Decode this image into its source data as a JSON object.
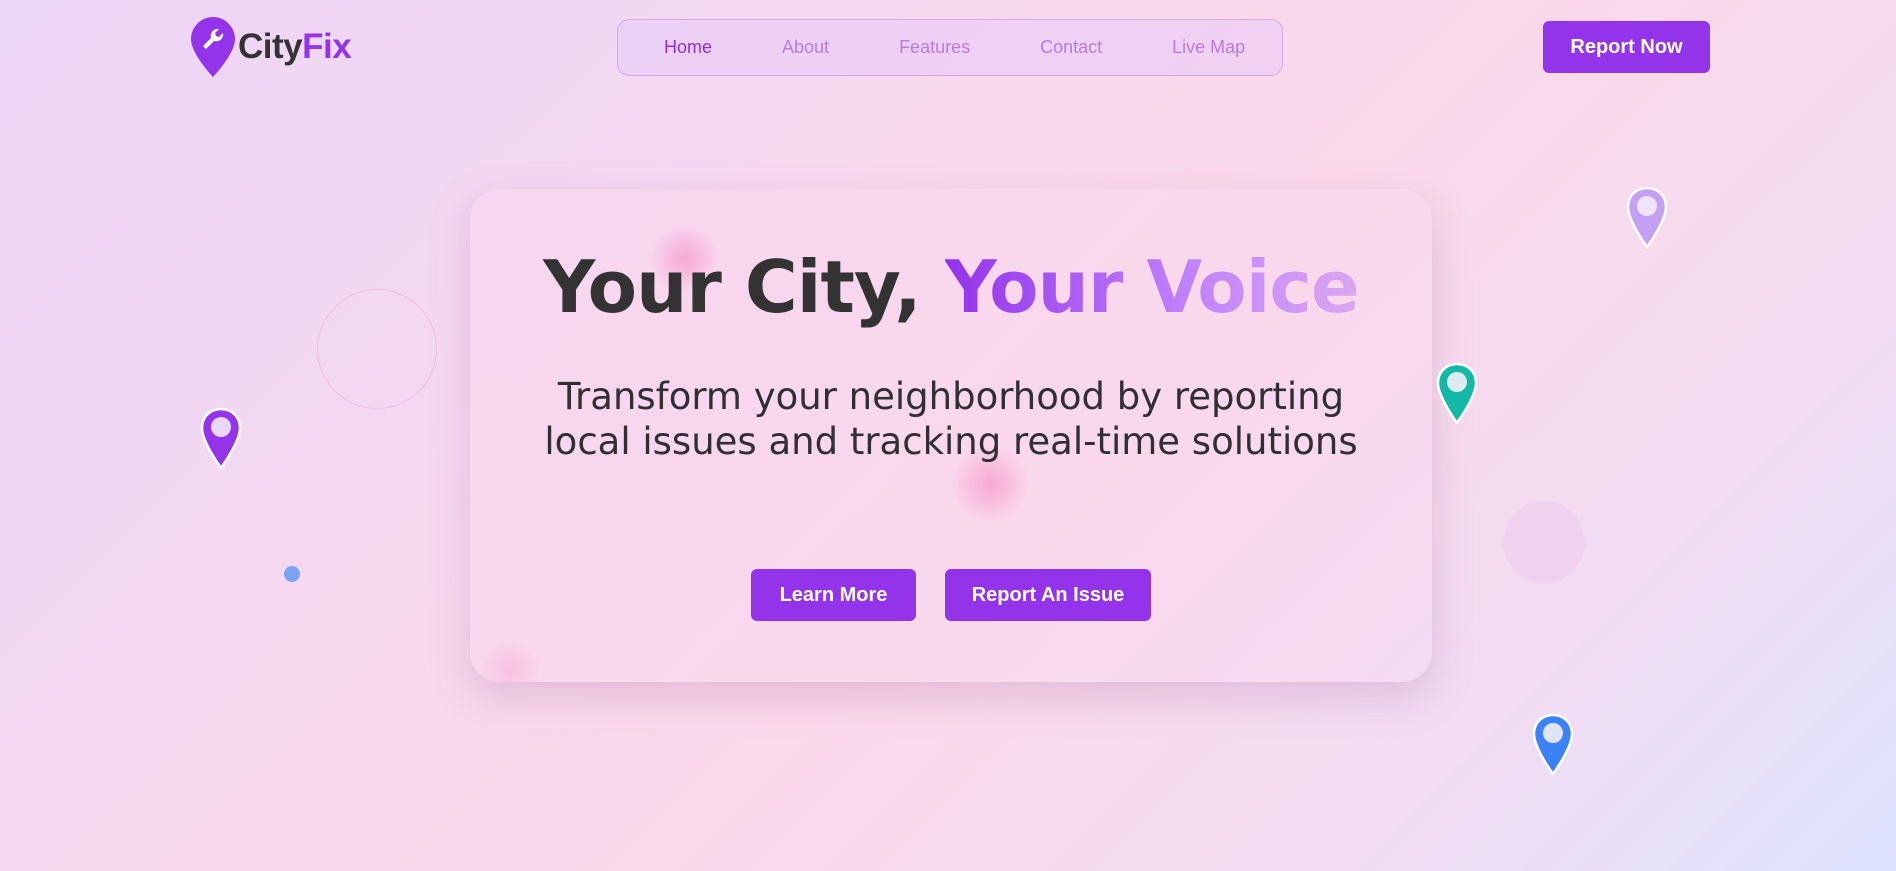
{
  "brand": {
    "name_part1": "City",
    "name_part2": "Fix",
    "accent": "#9333ea",
    "icon": "wrench-pin-icon"
  },
  "nav": {
    "items": [
      {
        "label": "Home",
        "active": true
      },
      {
        "label": "About",
        "active": false
      },
      {
        "label": "Features",
        "active": false
      },
      {
        "label": "Contact",
        "active": false
      },
      {
        "label": "Live Map",
        "active": false
      }
    ]
  },
  "header": {
    "cta_label": "Report Now"
  },
  "hero": {
    "title_plain": "Your City, ",
    "title_accent": "Your Voice",
    "subtitle": "Transform your neighborhood by reporting local issues and tracking real-time solutions",
    "primary_label": "Learn More",
    "secondary_label": "Report An Issue"
  },
  "markers": [
    {
      "name": "purple-map-marker-icon",
      "color": "#9333ea"
    },
    {
      "name": "lavender-map-marker-icon",
      "color": "#c3a0f2"
    },
    {
      "name": "teal-map-marker-icon",
      "color": "#14b8a6"
    },
    {
      "name": "blue-map-marker-icon",
      "color": "#3b82f6"
    }
  ]
}
